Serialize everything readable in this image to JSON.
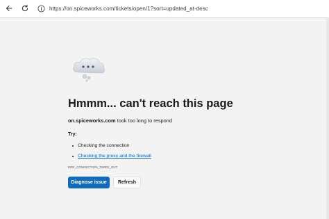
{
  "browser": {
    "url": "https://on.spiceworks.com/tickets/open/1?sort=updated_at-desc",
    "back_icon": "back-arrow-icon",
    "reload_icon": "reload-icon",
    "site_info_icon": "info-icon"
  },
  "error_page": {
    "illustration": "cloud-thinking-icon",
    "headline": "Hmmm... can't reach this page",
    "host": "on.spiceworks.com",
    "message": "took too long to respond",
    "try_label": "Try:",
    "suggestions": [
      {
        "label": "Checking the connection",
        "is_link": false
      },
      {
        "label": "Checking the proxy and the firewall",
        "is_link": true
      }
    ],
    "error_code": "ERR_CONNECTION_TIMED_OUT",
    "primary_button": "Diagnose issue",
    "secondary_button": "Refresh"
  },
  "colors": {
    "page_background": "#f3f3f3",
    "primary_button": "#0f6cbd",
    "link": "#0067c0"
  }
}
